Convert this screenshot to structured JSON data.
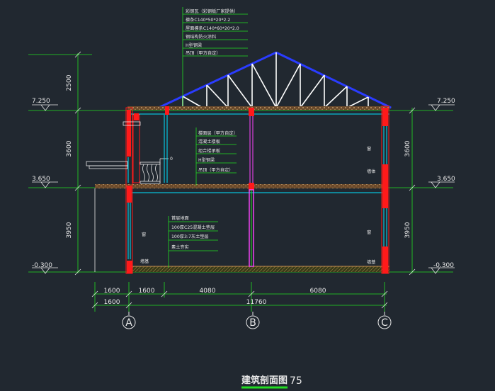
{
  "title": "建筑剖面图",
  "title_number": "75",
  "colors": {
    "background": "#212830",
    "roof_blue": "#2a3cff",
    "truss_white": "#ffffff",
    "wall_red": "#ff1a1a",
    "cyan": "#00e5ff",
    "green": "#22dd22",
    "magenta": "#ff44ff",
    "slab_brown": "#9a6a3a",
    "text": "#e8e8e8"
  },
  "levels": {
    "roof_top": "7.250",
    "upper_floor": "3.650",
    "ground": "-0.300"
  },
  "vertical_dims": {
    "roof_height": "2500",
    "second_storey": "3600",
    "first_storey": "3950"
  },
  "horizontal_dims": {
    "seg_a1": "1600",
    "seg_a2": "1600",
    "seg_ab": "4080",
    "seg_bc": "6080",
    "total_left": "1600",
    "total": "11760"
  },
  "axes": {
    "a": "A",
    "b": "B",
    "c": "C"
  },
  "roof_notes": [
    "彩钢瓦（彩钢板厂家提供）",
    "檩条C140*50*20*2.2",
    "屋面檩条C140*60*20*2.0",
    "钢结构防火涂料",
    "H型钢梁",
    "吊顶（甲方自定）"
  ],
  "floor_notes": [
    "楼面层（甲方自定）",
    "混凝土楼板",
    "组合楼承板",
    "H型钢梁",
    "吊顶（甲方自定）"
  ],
  "ground_notes": [
    "首层地面",
    "100厚C25混凝土垫层",
    "100厚3:7灰土垫层",
    "素土夯实"
  ],
  "wall_labels": {
    "railing_tag": "0",
    "a_wall_top": "窗",
    "a_wall_base": "墙基",
    "c_wall_upper": "窗",
    "c_wall_mid": "墙体",
    "c_wall_lower": "窗",
    "c_wall_base": "墙基"
  }
}
